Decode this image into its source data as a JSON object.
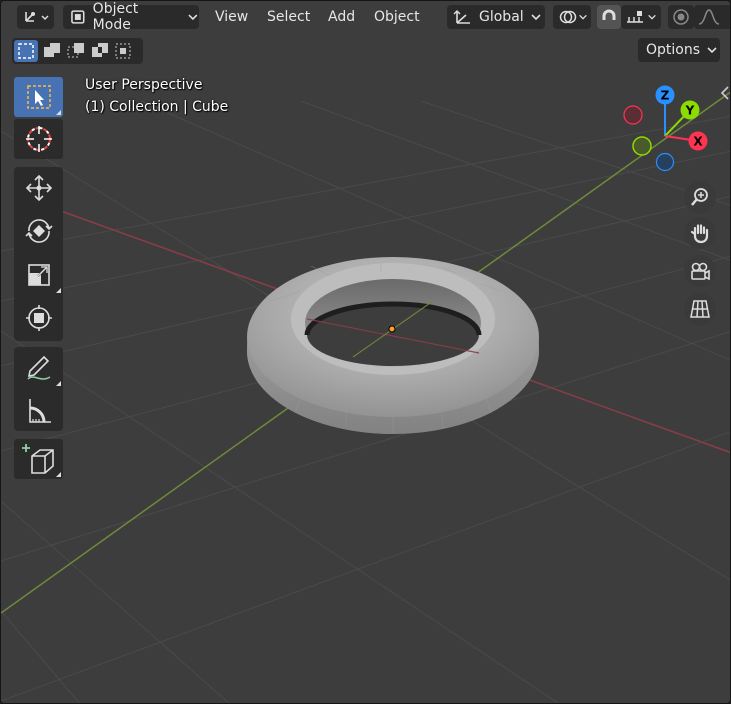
{
  "header": {
    "editor_type_icon": "axes-editor-icon",
    "mode_label": "Object Mode",
    "menus": [
      "View",
      "Select",
      "Add",
      "Object"
    ],
    "transform_orientation": "Global",
    "options_label": "Options"
  },
  "viewport_info": {
    "perspective": "User Perspective",
    "collection": "(1) Collection | Cube"
  },
  "gizmo": {
    "x_label": "X",
    "y_label": "Y",
    "z_label": "Z"
  },
  "tools": [
    {
      "name": "select-box",
      "icon": "select-box-icon",
      "active": true
    },
    {
      "name": "cursor",
      "icon": "cursor-icon",
      "active": false
    },
    {
      "name": "move",
      "icon": "move-icon",
      "active": false
    },
    {
      "name": "rotate",
      "icon": "rotate-icon",
      "active": false
    },
    {
      "name": "scale",
      "icon": "scale-icon",
      "active": false
    },
    {
      "name": "transform",
      "icon": "transform-icon",
      "active": false
    },
    {
      "name": "annotate",
      "icon": "annotate-icon",
      "active": false
    },
    {
      "name": "measure",
      "icon": "measure-icon",
      "active": false
    },
    {
      "name": "add-cube",
      "icon": "add-cube-icon",
      "active": false
    }
  ],
  "colors": {
    "background": "#3d3d3d",
    "x_axis": "#ff3352",
    "y_axis": "#8bdc00",
    "z_axis": "#2890ff",
    "active_tool": "#4772b3",
    "text": "#e6e6e6"
  }
}
